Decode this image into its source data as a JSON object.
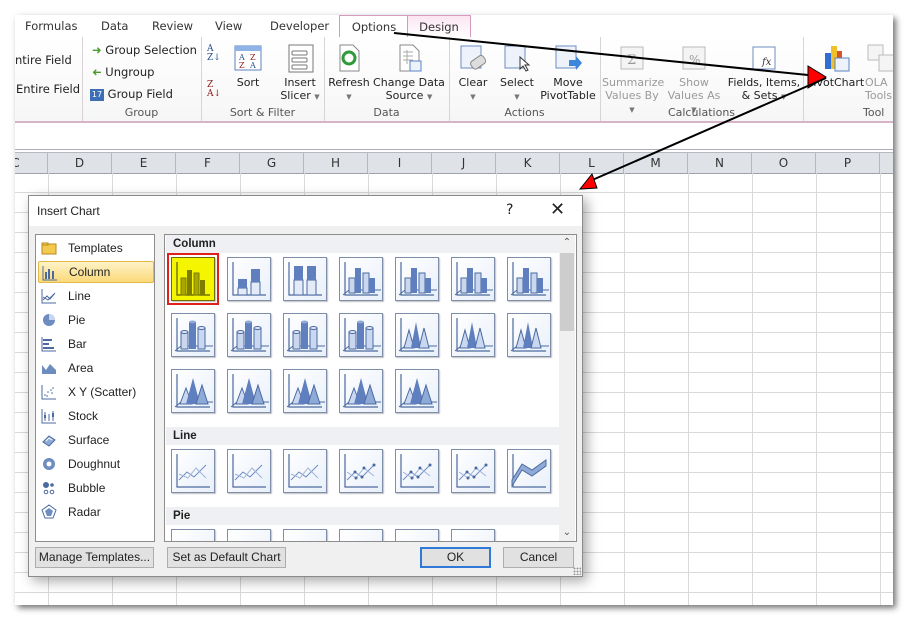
{
  "ribbon": {
    "tabs": [
      "Formulas",
      "Data",
      "Review",
      "View",
      "Developer"
    ],
    "context_tabs": [
      "Options",
      "Design"
    ],
    "active_tab": "Options",
    "groups": {
      "active_field_partial": {
        "expand": "ntire Field",
        "collapse": "Entire Field"
      },
      "group": {
        "label": "Group",
        "group_selection": "Group Selection",
        "ungroup": "Ungroup",
        "group_field": "Group Field"
      },
      "sort_filter": {
        "label": "Sort & Filter",
        "sort": "Sort",
        "insert_slicer_1": "Insert",
        "insert_slicer_2": "Slicer"
      },
      "data": {
        "label": "Data",
        "refresh": "Refresh",
        "change_source_1": "Change Data",
        "change_source_2": "Source"
      },
      "actions": {
        "label": "Actions",
        "clear": "Clear",
        "select": "Select",
        "move_1": "Move",
        "move_2": "PivotTable"
      },
      "calculations": {
        "label": "Calculations",
        "summarize_1": "Summarize",
        "summarize_2": "Values By",
        "show_1": "Show",
        "show_2": "Values As",
        "fields_1": "Fields, Items,",
        "fields_2": "& Sets"
      },
      "tools": {
        "label": "Tool",
        "pivotchart": "PivotChart",
        "olap_1": "OLA",
        "olap_2": "Tools"
      }
    }
  },
  "sheet": {
    "columns": [
      "C",
      "D",
      "E",
      "F",
      "G",
      "H",
      "I",
      "J",
      "K",
      "L",
      "M",
      "N",
      "O",
      "P"
    ]
  },
  "dialog": {
    "title": "Insert Chart",
    "help": "?",
    "close": "✕",
    "categories": [
      {
        "label": "Templates",
        "icon": "folder-icon"
      },
      {
        "label": "Column",
        "icon": "column-chart-icon",
        "selected": true
      },
      {
        "label": "Line",
        "icon": "line-chart-icon"
      },
      {
        "label": "Pie",
        "icon": "pie-chart-icon"
      },
      {
        "label": "Bar",
        "icon": "bar-chart-icon"
      },
      {
        "label": "Area",
        "icon": "area-chart-icon"
      },
      {
        "label": "X Y (Scatter)",
        "icon": "scatter-chart-icon"
      },
      {
        "label": "Stock",
        "icon": "stock-chart-icon"
      },
      {
        "label": "Surface",
        "icon": "surface-chart-icon"
      },
      {
        "label": "Doughnut",
        "icon": "doughnut-chart-icon"
      },
      {
        "label": "Bubble",
        "icon": "bubble-chart-icon"
      },
      {
        "label": "Radar",
        "icon": "radar-chart-icon"
      }
    ],
    "sections": [
      {
        "title": "Column",
        "rows": [
          7,
          7,
          5
        ],
        "kinds": [
          "col",
          "col",
          "col",
          "col3d",
          "col3d",
          "col3d",
          "col3d",
          "cyl",
          "cyl",
          "cyl",
          "cyl",
          "cone",
          "cone",
          "cone",
          "pyr",
          "pyr",
          "pyr",
          "pyr",
          "pyr"
        ]
      },
      {
        "title": "Line",
        "rows": [
          7
        ],
        "kinds": [
          "line",
          "line",
          "line",
          "linem",
          "linem",
          "linem",
          "line3d"
        ]
      },
      {
        "title": "Pie",
        "rows": [
          6
        ],
        "kinds": [
          "pie",
          "pie",
          "pie",
          "pie",
          "pie",
          "pie"
        ]
      }
    ],
    "buttons": {
      "manage_templates": "Manage Templates...",
      "set_default": "Set as Default Chart",
      "ok": "OK",
      "cancel": "Cancel"
    }
  },
  "colors": {
    "selected_thumb": "#f6f500",
    "highlight_border": "#e0201b",
    "annotation_arrow": "#ff0000"
  }
}
